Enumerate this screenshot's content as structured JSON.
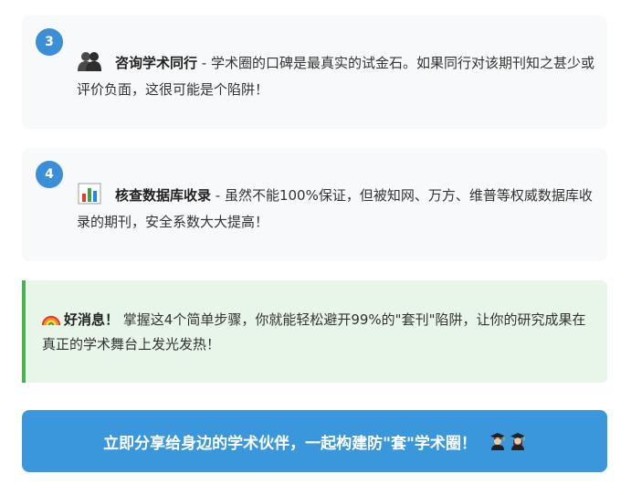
{
  "steps": [
    {
      "number": "3",
      "icon": "people-silhouette-icon",
      "title": "咨询学术同行",
      "description": " - 学术圈的口碑是最真实的试金石。如果同行对该期刊知之甚少或评价负面，这很可能是个陷阱！"
    },
    {
      "number": "4",
      "icon": "bar-chart-icon",
      "title": "核查数据库收录",
      "description": " - 虽然不能100%保证，但被知网、万方、维普等权威数据库收录的期刊，安全系数大大提高！"
    }
  ],
  "good_news": {
    "icon": "rainbow-icon",
    "title": "好消息！",
    "text": " 掌握这4个简单步骤，你就能轻松避开99%的\"套刊\"陷阱，让你的研究成果在真正的学术舞台上发光发热！"
  },
  "cta": {
    "label": "立即分享给身边的学术伙伴，一起构建防\"套\"学术圈！",
    "icons": [
      "graduate-male-icon",
      "graduate-female-icon"
    ]
  },
  "colors": {
    "accent_blue": "#3a97dc",
    "card_bg": "#f8f9fa",
    "good_bg": "#e8f5e9",
    "good_border": "#4caf50"
  }
}
